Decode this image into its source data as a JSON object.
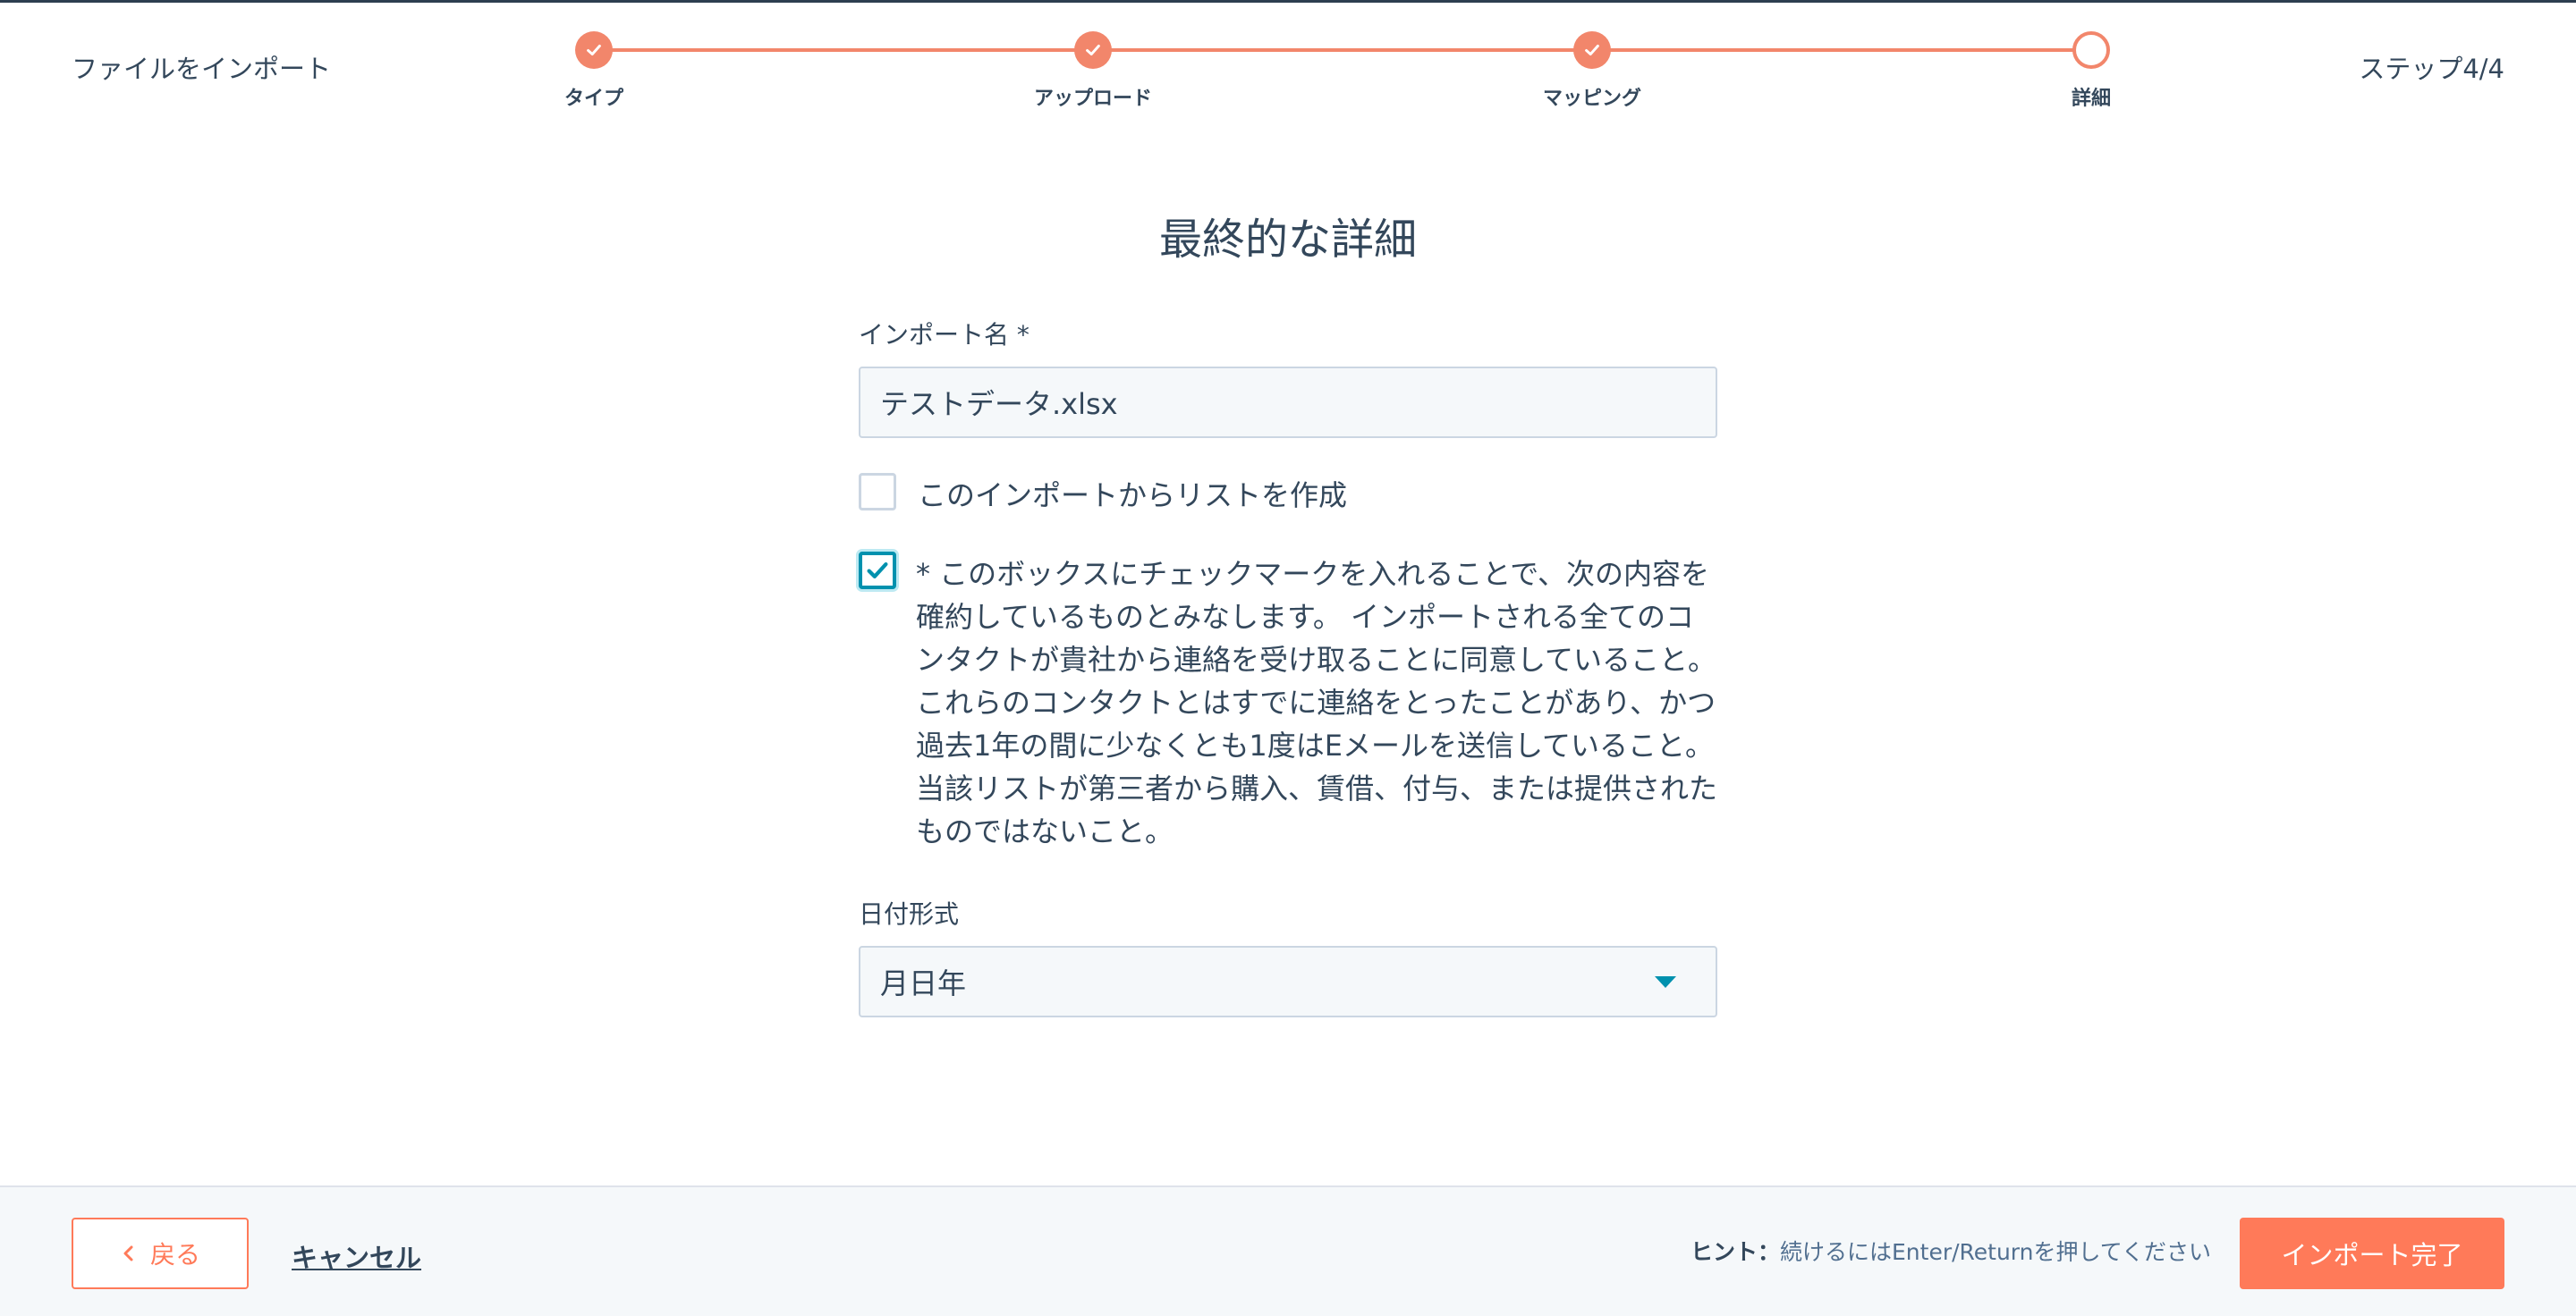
{
  "header": {
    "title": "ファイルをインポート",
    "step_indicator": "ステップ4/4"
  },
  "stepper": {
    "steps": [
      {
        "label": "タイプ",
        "status": "complete"
      },
      {
        "label": "アップロード",
        "status": "complete"
      },
      {
        "label": "マッピング",
        "status": "complete"
      },
      {
        "label": "詳細",
        "status": "current"
      }
    ]
  },
  "form": {
    "title": "最終的な詳細",
    "import_name": {
      "label": "インポート名 *",
      "value": "テストデータ.xlsx"
    },
    "create_list": {
      "label": "このインポートからリストを作成",
      "checked": false
    },
    "consent": {
      "text": "* このボックスにチェックマークを入れることで、次の内容を確約しているものとみなします。 インポートされる全てのコンタクトが貴社から連絡を受け取ることに同意していること。これらのコンタクトとはすでに連絡をとったことがあり、かつ過去1年の間に少なくとも1度はEメールを送信していること。当該リストが第三者から購入、賃借、付与、または提供されたものではないこと。",
      "checked": true
    },
    "date_format": {
      "label": "日付形式",
      "value": "月日年"
    }
  },
  "footer": {
    "back_label": "戻る",
    "cancel_label": "キャンセル",
    "hint_prefix": "ヒント：",
    "hint_text": "続けるにはEnter/Returnを押してください",
    "finish_label": "インポート完了"
  },
  "colors": {
    "accent": "#ff7a59",
    "stepper": "#f2866b",
    "focus": "#0091ae",
    "text": "#33475b"
  }
}
